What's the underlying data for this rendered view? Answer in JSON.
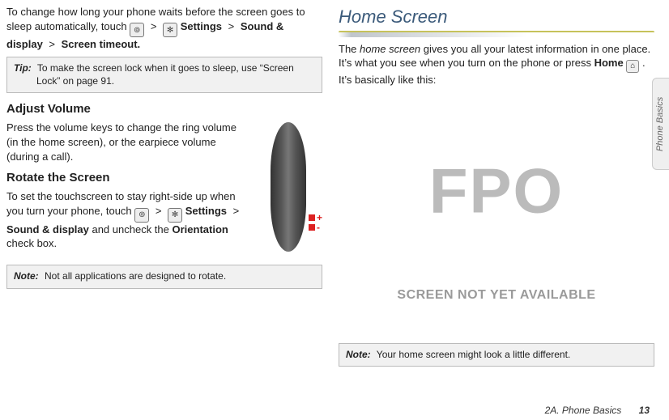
{
  "left": {
    "intro_a": "To change how long your phone waits before the screen goes to sleep automatically, touch ",
    "path_last": "Screen timeout.",
    "settings_label": "Settings",
    "sound_display_label": "Sound & display",
    "gt": ">",
    "tip": {
      "label": "Tip:",
      "text": "To make the screen lock when it goes to sleep, use “Screen Lock” on page 91."
    },
    "adjust_volume_head": "Adjust Volume",
    "adjust_volume_body": "Press the volume keys to change the ring volume (in the home screen), or the earpiece volume (during a call).",
    "rotate_head": "Rotate the Screen",
    "rotate_body_a": "To set the touchscreen to stay right-side up when you turn your phone, touch ",
    "rotate_body_b": " and uncheck the ",
    "orientation_label": "Orientation",
    "rotate_body_c": " check box.",
    "note1": {
      "label": "Note:",
      "text": "Not all applications are designed to rotate."
    },
    "vol_plus": "+",
    "vol_minus": "-"
  },
  "right": {
    "title": "Home Screen",
    "body_a": "The ",
    "body_em": "home screen",
    "body_b": " gives you all your latest information in one place. It’s what you see when you turn on the phone or press ",
    "home_label": "Home",
    "body_c": ". It’s basically like this:",
    "fpo": "FPO",
    "fpo_caption": "SCREEN NOT YET AVAILABLE",
    "note2": {
      "label": "Note:",
      "text": "Your home screen might look a little different."
    }
  },
  "tab": "Phone Basics",
  "footer": {
    "section": "2A. Phone Basics",
    "page": "13"
  }
}
